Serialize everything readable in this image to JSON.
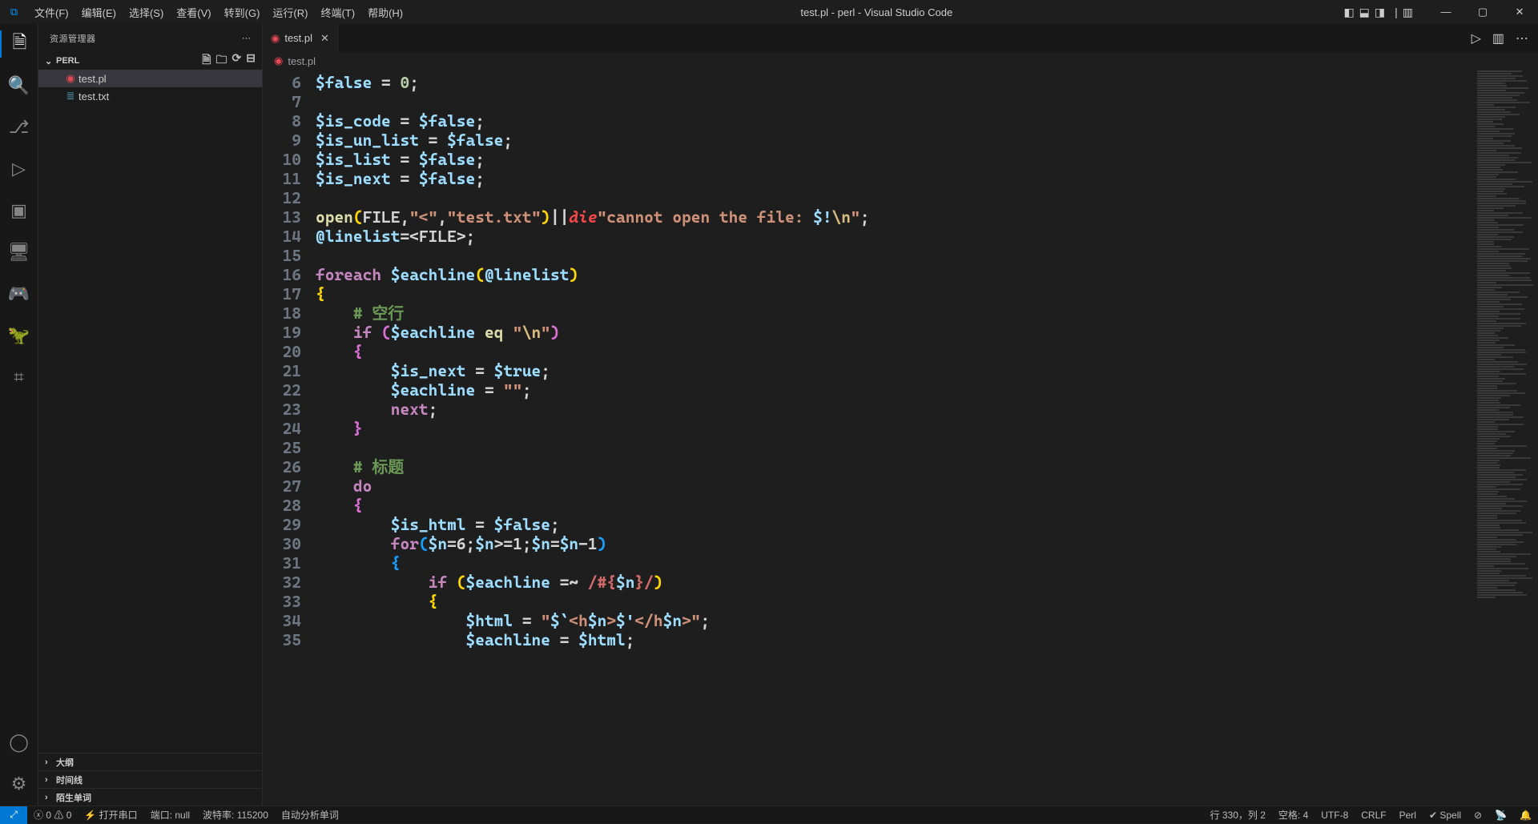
{
  "titlebar": {
    "title": "test.pl - perl - Visual Studio Code",
    "menu": [
      "文件(F)",
      "编辑(E)",
      "选择(S)",
      "查看(V)",
      "转到(G)",
      "运行(R)",
      "终端(T)",
      "帮助(H)"
    ]
  },
  "sidebar": {
    "title": "资源管理器",
    "folder": "PERL",
    "files": [
      {
        "name": "test.pl",
        "icon": "perl",
        "active": true
      },
      {
        "name": "test.txt",
        "icon": "txt",
        "active": false
      }
    ],
    "sections": [
      "大纲",
      "时间线",
      "陌生单词"
    ]
  },
  "tabs": {
    "items": [
      {
        "name": "test.pl",
        "icon": "perl"
      }
    ],
    "breadcrumb": "test.pl"
  },
  "code": {
    "first_line": 6,
    "lines": [
      [
        [
          "var",
          "$false"
        ],
        [
          "op",
          " = "
        ],
        [
          "num",
          "0"
        ],
        [
          "op",
          ";"
        ]
      ],
      [],
      [
        [
          "var",
          "$is_code"
        ],
        [
          "op",
          " = "
        ],
        [
          "var",
          "$false"
        ],
        [
          "op",
          ";"
        ]
      ],
      [
        [
          "var",
          "$is_un_list"
        ],
        [
          "op",
          " = "
        ],
        [
          "var",
          "$false"
        ],
        [
          "op",
          ";"
        ]
      ],
      [
        [
          "var",
          "$is_list"
        ],
        [
          "op",
          " = "
        ],
        [
          "var",
          "$false"
        ],
        [
          "op",
          ";"
        ]
      ],
      [
        [
          "var",
          "$is_next"
        ],
        [
          "op",
          " = "
        ],
        [
          "var",
          "$false"
        ],
        [
          "op",
          ";"
        ]
      ],
      [],
      [
        [
          "fn",
          "open"
        ],
        [
          "brace",
          "("
        ],
        [
          "op",
          "FILE,"
        ],
        [
          "str",
          "\"<\""
        ],
        [
          "op",
          ","
        ],
        [
          "str",
          "\"test.txt\""
        ],
        [
          "brace",
          ")"
        ],
        [
          "op",
          "||"
        ],
        [
          "die",
          "die"
        ],
        [
          "str",
          "\"cannot open the file: "
        ],
        [
          "var",
          "$!"
        ],
        [
          "esc",
          "\\n"
        ],
        [
          "str",
          "\""
        ],
        [
          "op",
          ";"
        ]
      ],
      [
        [
          "var",
          "@linelist"
        ],
        [
          "op",
          "=<FILE>;"
        ]
      ],
      [],
      [
        [
          "kw",
          "foreach"
        ],
        [
          "op",
          " "
        ],
        [
          "var",
          "$eachline"
        ],
        [
          "brace",
          "("
        ],
        [
          "var",
          "@linelist"
        ],
        [
          "brace",
          ")"
        ]
      ],
      [
        [
          "brace",
          "{"
        ]
      ],
      [
        [
          "op",
          "    "
        ],
        [
          "cmt",
          "# 空行"
        ]
      ],
      [
        [
          "op",
          "    "
        ],
        [
          "kw",
          "if"
        ],
        [
          "op",
          " "
        ],
        [
          "brace2",
          "("
        ],
        [
          "var",
          "$eachline"
        ],
        [
          "op",
          " "
        ],
        [
          "fn",
          "eq"
        ],
        [
          "op",
          " "
        ],
        [
          "str",
          "\""
        ],
        [
          "esc",
          "\\n"
        ],
        [
          "str",
          "\""
        ],
        [
          "brace2",
          ")"
        ]
      ],
      [
        [
          "op",
          "    "
        ],
        [
          "brace2",
          "{"
        ]
      ],
      [
        [
          "op",
          "        "
        ],
        [
          "var",
          "$is_next"
        ],
        [
          "op",
          " = "
        ],
        [
          "var",
          "$true"
        ],
        [
          "op",
          ";"
        ]
      ],
      [
        [
          "op",
          "        "
        ],
        [
          "var",
          "$eachline"
        ],
        [
          "op",
          " = "
        ],
        [
          "str",
          "\"\""
        ],
        [
          "op",
          ";"
        ]
      ],
      [
        [
          "op",
          "        "
        ],
        [
          "next",
          "next"
        ],
        [
          "op",
          ";"
        ]
      ],
      [
        [
          "op",
          "    "
        ],
        [
          "brace2",
          "}"
        ]
      ],
      [],
      [
        [
          "op",
          "    "
        ],
        [
          "cmt",
          "# 标题"
        ]
      ],
      [
        [
          "op",
          "    "
        ],
        [
          "kw",
          "do"
        ]
      ],
      [
        [
          "op",
          "    "
        ],
        [
          "brace2",
          "{"
        ]
      ],
      [
        [
          "op",
          "        "
        ],
        [
          "var",
          "$is_html"
        ],
        [
          "op",
          " = "
        ],
        [
          "var",
          "$false"
        ],
        [
          "op",
          ";"
        ]
      ],
      [
        [
          "op",
          "        "
        ],
        [
          "kw",
          "for"
        ],
        [
          "brace3",
          "("
        ],
        [
          "var",
          "$n"
        ],
        [
          "op",
          "=6;"
        ],
        [
          "var",
          "$n"
        ],
        [
          "op",
          ">=1;"
        ],
        [
          "var",
          "$n"
        ],
        [
          "op",
          "="
        ],
        [
          "var",
          "$n"
        ],
        [
          "op",
          "-1"
        ],
        [
          "brace3",
          ")"
        ]
      ],
      [
        [
          "op",
          "        "
        ],
        [
          "brace3",
          "{"
        ]
      ],
      [
        [
          "op",
          "            "
        ],
        [
          "kw",
          "if"
        ],
        [
          "op",
          " "
        ],
        [
          "brace",
          "("
        ],
        [
          "var",
          "$eachline"
        ],
        [
          "op",
          " =~ "
        ],
        [
          "regex",
          "/#{"
        ],
        [
          "var",
          "$n"
        ],
        [
          "regex",
          "}/"
        ],
        [
          "brace",
          ")"
        ]
      ],
      [
        [
          "op",
          "            "
        ],
        [
          "brace",
          "{"
        ]
      ],
      [
        [
          "op",
          "                "
        ],
        [
          "var",
          "$html"
        ],
        [
          "op",
          " = "
        ],
        [
          "str",
          "\""
        ],
        [
          "var",
          "$`"
        ],
        [
          "str",
          "<h"
        ],
        [
          "var",
          "$n"
        ],
        [
          "str",
          ">"
        ],
        [
          "var",
          "$'"
        ],
        [
          "str",
          "</h"
        ],
        [
          "var",
          "$n"
        ],
        [
          "str",
          ">\""
        ],
        [
          "op",
          ";"
        ]
      ],
      [
        [
          "op",
          "                "
        ],
        [
          "var",
          "$eachline"
        ],
        [
          "op",
          " = "
        ],
        [
          "var",
          "$html"
        ],
        [
          "op",
          ";"
        ]
      ]
    ]
  },
  "statusbar": {
    "errors": "0",
    "warnings": "0",
    "open_serial": "打开串口",
    "port": "端口: null",
    "baud": "波特率: 115200",
    "analysis": "自动分析单词",
    "cursor": "行 330，列 2",
    "spaces": "空格: 4",
    "encoding": "UTF-8",
    "eol": "CRLF",
    "lang": "Perl",
    "spell": "Spell"
  }
}
